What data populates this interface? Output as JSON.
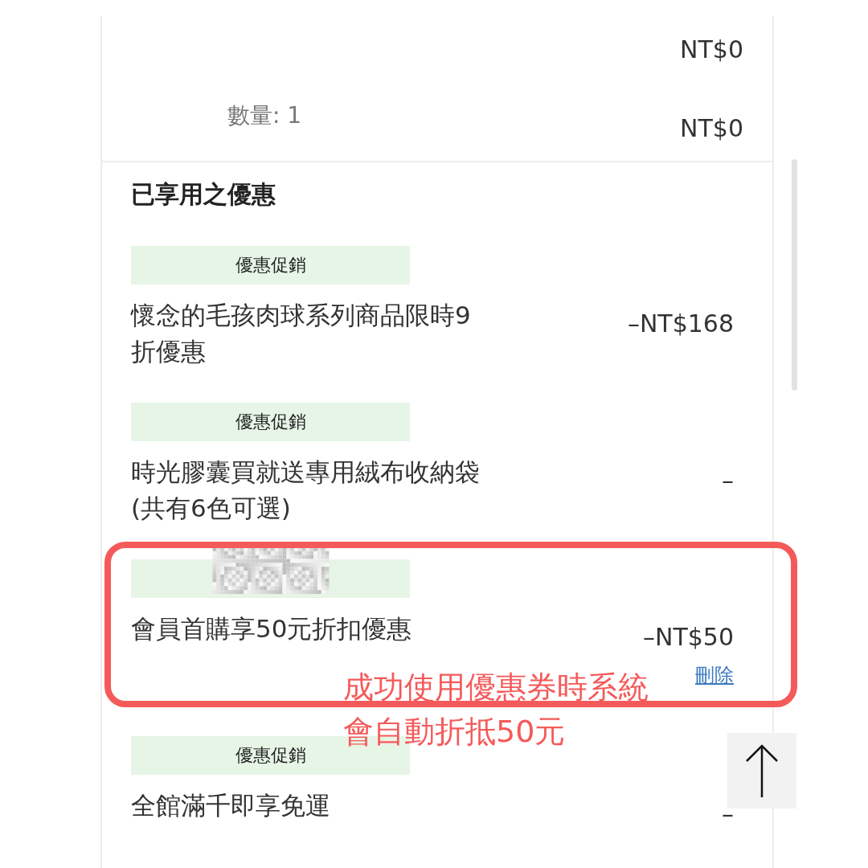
{
  "item_prices": {
    "price": "NT$0",
    "quantity": "數量: 1",
    "subtotal": "NT$0"
  },
  "promotions": {
    "heading": "已享用之優惠",
    "items": [
      {
        "tag": {
          "kind": "label",
          "text": "優惠促銷"
        },
        "title": "懷念的毛孩肉球系列商品限時9折優惠",
        "amount": "–NT$168"
      },
      {
        "tag": {
          "kind": "label",
          "text": "優惠促銷"
        },
        "title": "時光膠囊買就送專用絨布收納袋(共有6色可選)",
        "amount": "–"
      },
      {
        "tag": {
          "kind": "redacted"
        },
        "title": "會員首購享50元折扣優惠",
        "amount": "–NT$50",
        "delete_link": "刪除",
        "highlighted": true
      },
      {
        "tag": {
          "kind": "label",
          "text": "優惠促銷"
        },
        "title": "全館滿千即享免運",
        "amount": "–"
      }
    ]
  },
  "annotation": {
    "lines": [
      "成功使用優惠券時系統",
      "會自動折抵50元"
    ]
  }
}
